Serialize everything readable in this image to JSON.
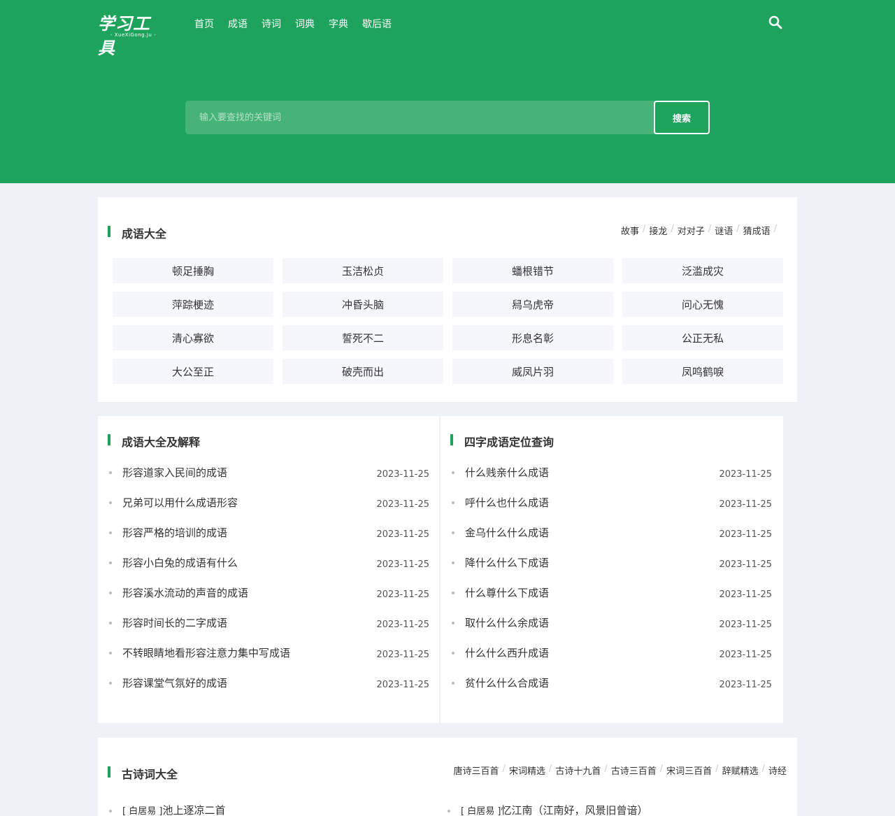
{
  "header": {
    "logo_main": "学习工具",
    "logo_sub": "- XueXiGong.Ju -",
    "nav": [
      "首页",
      "成语",
      "诗词",
      "词典",
      "字典",
      "歇后语"
    ],
    "search": {
      "placeholder": "输入要查找的关键词",
      "button": "搜索"
    }
  },
  "idioms": {
    "title": "成语大全",
    "links": [
      "故事",
      "接龙",
      "对对子",
      "谜语",
      "猜成语"
    ],
    "items": [
      "顿足捶胸",
      "玉洁松贞",
      "蟠根错节",
      "泛滥成灾",
      "萍踪梗迹",
      "冲昏头脑",
      "舄乌虎帝",
      "问心无愧",
      "清心寡欲",
      "誓死不二",
      "形息名彰",
      "公正无私",
      "大公至正",
      "破壳而出",
      "威凤片羽",
      "凤鸣鹤唳"
    ]
  },
  "explain": {
    "title": "成语大全及解释",
    "items": [
      {
        "title": "形容道家入民间的成语",
        "date": "2023-11-25"
      },
      {
        "title": "兄弟可以用什么成语形容",
        "date": "2023-11-25"
      },
      {
        "title": "形容严格的培训的成语",
        "date": "2023-11-25"
      },
      {
        "title": "形容小白兔的成语有什么",
        "date": "2023-11-25"
      },
      {
        "title": "形容溪水流动的声音的成语",
        "date": "2023-11-25"
      },
      {
        "title": "形容时间长的二字成语",
        "date": "2023-11-25"
      },
      {
        "title": "不转眼睛地看形容注意力集中写成语",
        "date": "2023-11-25"
      },
      {
        "title": "形容课堂气氛好的成语",
        "date": "2023-11-25"
      }
    ]
  },
  "fourchar": {
    "title": "四字成语定位查询",
    "items": [
      {
        "title": "什么贱亲什么成语",
        "date": "2023-11-25"
      },
      {
        "title": "呼什么也什么成语",
        "date": "2023-11-25"
      },
      {
        "title": "金乌什么什么成语",
        "date": "2023-11-25"
      },
      {
        "title": "降什么什么下成语",
        "date": "2023-11-25"
      },
      {
        "title": "什么尊什么下成语",
        "date": "2023-11-25"
      },
      {
        "title": "取什么什么余成语",
        "date": "2023-11-25"
      },
      {
        "title": "什么什么西升成语",
        "date": "2023-11-25"
      },
      {
        "title": "贫什么什么合成语",
        "date": "2023-11-25"
      }
    ]
  },
  "poems": {
    "title": "古诗词大全",
    "links": [
      "唐诗三百首",
      "宋词精选",
      "古诗十九首",
      "古诗三百首",
      "宋词三百首",
      "辞赋精选",
      "诗经"
    ],
    "rows": [
      {
        "author": "白居易",
        "title": "池上逐凉二首"
      },
      {
        "author": "白居易",
        "title": "忆江南（江南好，风景旧曾谙）"
      }
    ]
  },
  "colors": {
    "brand": "#1ea35c",
    "background": "#eef1f5",
    "card": "#ffffff"
  }
}
